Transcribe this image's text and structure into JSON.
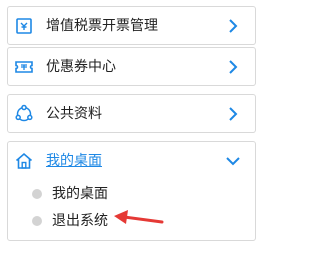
{
  "menu": {
    "items": [
      {
        "label": "增值税票开票管理",
        "icon": "invoice-icon",
        "state": "collapsed"
      },
      {
        "label": "优惠券中心",
        "icon": "coupon-icon",
        "state": "collapsed"
      },
      {
        "label": "公共资料",
        "icon": "share-icon",
        "state": "collapsed"
      },
      {
        "label": "我的桌面",
        "icon": "home-icon",
        "state": "expanded"
      }
    ],
    "submenu": [
      {
        "label": "我的桌面"
      },
      {
        "label": "退出系统"
      }
    ]
  },
  "colors": {
    "accent": "#1e88e5",
    "text": "#222222",
    "border": "#d9d9d9",
    "dot": "#d3d3d3",
    "arrow": "#e53935"
  }
}
